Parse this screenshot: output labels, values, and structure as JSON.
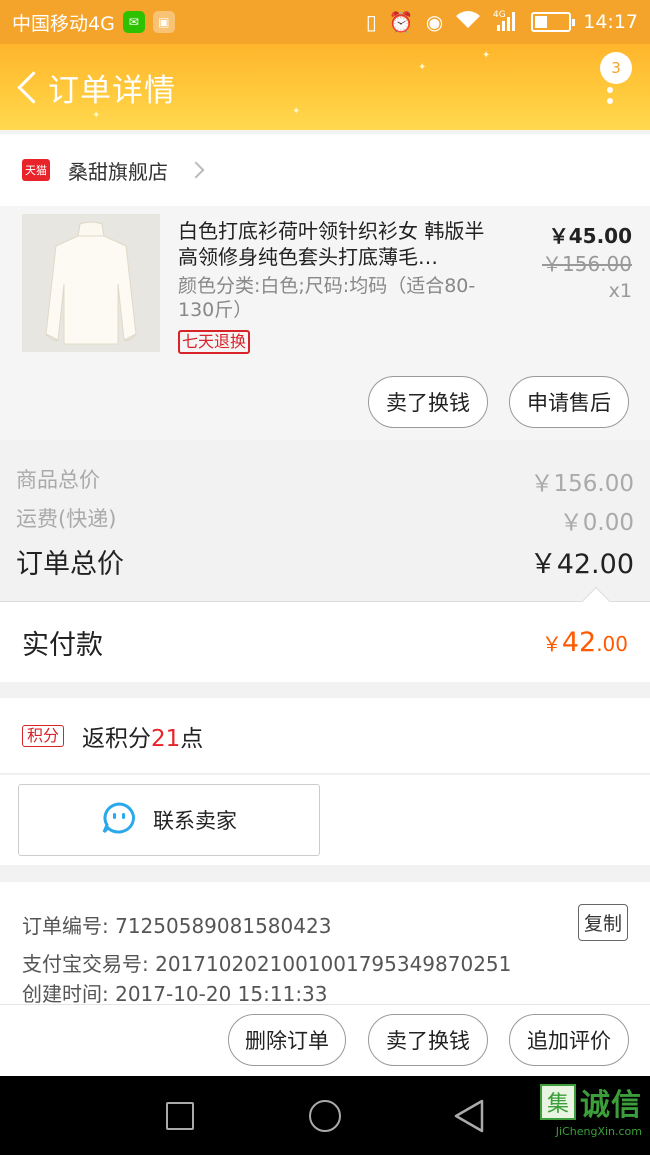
{
  "status_bar": {
    "carrier": "中国移动4G",
    "network": "4G",
    "time": "14:17"
  },
  "header": {
    "title": "订单详情",
    "notification_count": "3"
  },
  "shop": {
    "tag": "天猫",
    "name": "桑甜旗舰店"
  },
  "product": {
    "title": "白色打底衫荷叶领针织衫女 韩版半高领修身纯色套头打底薄毛…",
    "spec": "颜色分类:白色;尺码:均码（适合80-130斤）",
    "return_tag": "七天退换",
    "price": "￥45.00",
    "original_price": "￥156.00",
    "quantity": "x1",
    "buttons": {
      "resell": "卖了换钱",
      "after_sales": "申请售后"
    }
  },
  "summary": {
    "goods_total_label": "商品总价",
    "goods_total": "￥156.00",
    "shipping_label": "运费(快递)",
    "shipping": "￥0.00",
    "order_total_label": "订单总价",
    "order_total": "￥42.00"
  },
  "paid": {
    "label": "实付款",
    "currency": "￥",
    "integer": "42",
    "decimal": ".00"
  },
  "points": {
    "tag": "积分",
    "prefix": "返积分",
    "value": "21",
    "suffix": "点"
  },
  "contact": {
    "label": "联系卖家"
  },
  "order_info": {
    "order_no": "订单编号: 71250589081580423",
    "alipay_no": "支付宝交易号: 2017102021001001795349870251",
    "created": "创建时间: 2017-10-20 15:11:33",
    "copy_label": "复制"
  },
  "actions": {
    "delete": "删除订单",
    "resell": "卖了换钱",
    "review": "追加评价"
  },
  "watermark": {
    "box": "集",
    "text": "诚信",
    "sub": "JiChengXin.com"
  },
  "colors": {
    "header": "#ffc73a",
    "accent": "#ff5a00",
    "tmall_red": "#e8232a"
  }
}
